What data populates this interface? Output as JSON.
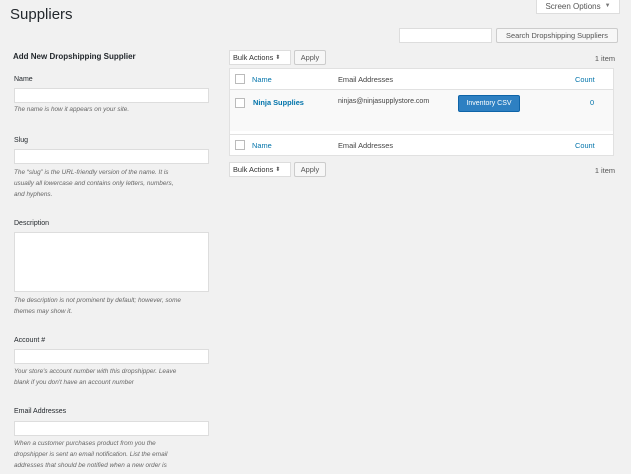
{
  "header": {
    "title": "Suppliers",
    "screen_options": "Screen Options",
    "search_button": "Search Dropshipping Suppliers",
    "search_value": ""
  },
  "form": {
    "title": "Add New Dropshipping Supplier",
    "name_label": "Name",
    "name_hint": "The name is how it appears on your site.",
    "slug_label": "Slug",
    "slug_hint_1": "The “slug” is the URL-friendly version of the name. It is",
    "slug_hint_2": "usually all lowercase and contains only letters, numbers,",
    "slug_hint_3": "and hyphens.",
    "description_label": "Description",
    "description_hint_1": "The description is not prominent by default; however, some",
    "description_hint_2": "themes may show it.",
    "account_label": "Account #",
    "account_hint_1": "Your store's account number with this dropshipper. Leave",
    "account_hint_2": "blank if you don't have an account number",
    "email_label": "Email Addresses",
    "email_hint_1": "When a customer purchases product from you the",
    "email_hint_2": "dropshipper is sent an email notification. List the email",
    "email_hint_3": "addresses that should be notified when a new order is"
  },
  "table": {
    "bulk_actions": "Bulk Actions",
    "apply": "Apply",
    "item_count": "1 item",
    "columns": {
      "name": "Name",
      "email": "Email Addresses",
      "count": "Count"
    },
    "rows": [
      {
        "name": "Ninja Supplies",
        "email": "ninjas@ninjasupplystore.com",
        "button": "Inventory CSV",
        "count": "0"
      }
    ]
  },
  "colors": {
    "link": "#0073aa",
    "primary_button": "#2e80c2",
    "background": "#f1f1f1"
  }
}
